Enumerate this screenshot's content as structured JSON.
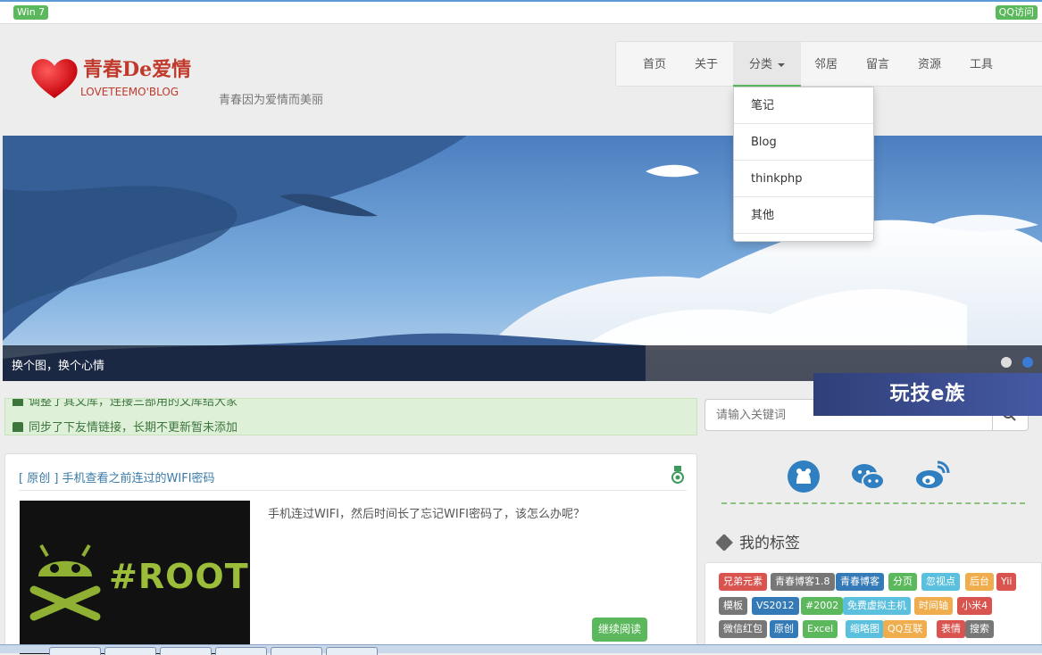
{
  "topbar": {
    "left_badge": "Win 7",
    "right_badge": "QQ访问"
  },
  "logo": {
    "title": "青春De爱情",
    "subtitle": "LOVETEEMO'BLOG"
  },
  "slogan": "青春因为爱情而美丽",
  "nav": {
    "items": [
      {
        "label": "首页"
      },
      {
        "label": "关于"
      },
      {
        "label": "分类"
      },
      {
        "label": "邻居"
      },
      {
        "label": "留言"
      },
      {
        "label": "资源"
      },
      {
        "label": "工具"
      }
    ],
    "dropdown": [
      "笔记",
      "Blog",
      "thinkphp",
      "其他"
    ]
  },
  "banner": {
    "caption": "换个图，换个心情",
    "ad_text": "玩技e族"
  },
  "notice": {
    "line1": "调整了其文库，连接三部用的文库结大家",
    "line2": "同步了下友情链接，长期不更新暂未添加"
  },
  "search": {
    "placeholder": "请输入关键词"
  },
  "article": {
    "title": "[ 原创 ] 手机查看之前连过的WIFI密码",
    "summary": "手机连过WIFI，然后时间长了忘记WIFI密码了，该怎么办呢？",
    "thumb_text": "#ROOT",
    "read_more": "继续阅读"
  },
  "sidebar": {
    "tags_title": "我的标签",
    "tags": [
      {
        "label": "兄弟元素",
        "color": "#d9534f"
      },
      {
        "label": "青春博客1.8",
        "color": "#777777"
      },
      {
        "label": "青春博客",
        "color": "#337ab7"
      },
      {
        "label": "分页",
        "color": "#5cb85c"
      },
      {
        "label": "忽视点",
        "color": "#5bc0de"
      },
      {
        "label": "后台",
        "color": "#f0ad4e"
      },
      {
        "label": "Yii",
        "color": "#d9534f"
      },
      {
        "label": "模板",
        "color": "#777777"
      },
      {
        "label": "VS2012",
        "color": "#337ab7"
      },
      {
        "label": "#2002",
        "color": "#5cb85c"
      },
      {
        "label": "免费虚拟主机",
        "color": "#5bc0de"
      },
      {
        "label": "时间轴",
        "color": "#f0ad4e"
      },
      {
        "label": "小米4",
        "color": "#d9534f"
      },
      {
        "label": "微信红包",
        "color": "#777777"
      },
      {
        "label": "原创",
        "color": "#337ab7"
      },
      {
        "label": "Excel",
        "color": "#5cb85c"
      },
      {
        "label": "缩略图",
        "color": "#5bc0de"
      },
      {
        "label": "QQ互联",
        "color": "#f0ad4e"
      },
      {
        "label": "表情",
        "color": "#d9534f"
      },
      {
        "label": "搜索",
        "color": "#777777"
      }
    ]
  },
  "colors": {
    "accent_green": "#5cb85c",
    "link_blue": "#3a7aa8",
    "logo_red": "#c0392b"
  }
}
